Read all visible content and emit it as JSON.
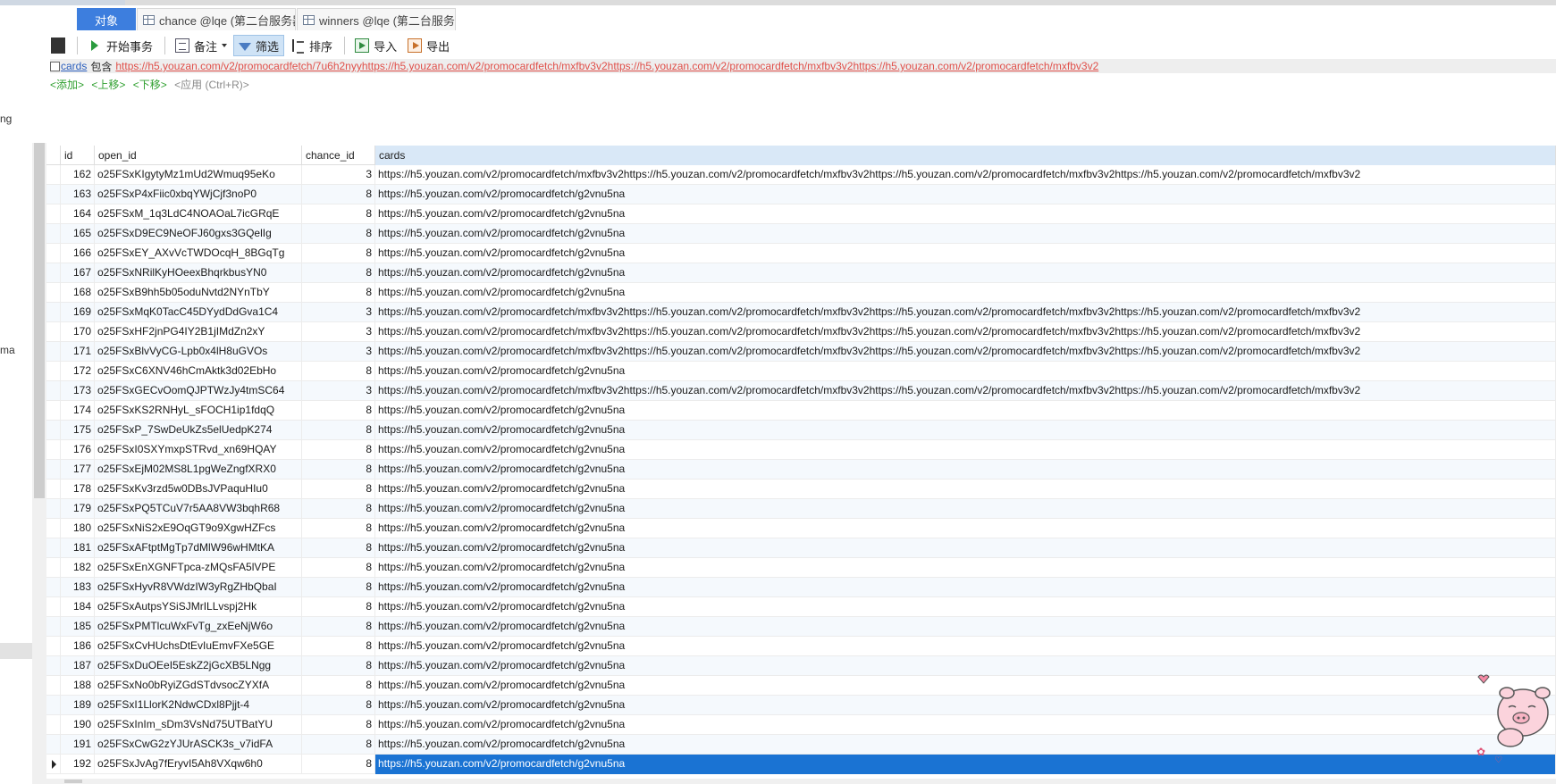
{
  "left_panel": {
    "fragments": [
      "ng",
      "ma"
    ]
  },
  "tabs": [
    {
      "label": "对象",
      "active": true,
      "icon": "none"
    },
    {
      "label": "chance @lqe (第二台服务器)",
      "active": false,
      "icon": "table-icon"
    },
    {
      "label": "winners @lqe (第二台服务器)...",
      "active": false,
      "icon": "table-icon"
    }
  ],
  "toolbar": {
    "begin_transaction": "开始事务",
    "note": "备注",
    "filter": "筛选",
    "sort": "排序",
    "import": "导入",
    "export": "导出"
  },
  "filter": {
    "field": "cards",
    "operator": "包含",
    "value": "https://h5.youzan.com/v2/promocardfetch/7u6h2nyyhttps://h5.youzan.com/v2/promocardfetch/mxfbv3v2https://h5.youzan.com/v2/promocardfetch/mxfbv3v2https://h5.youzan.com/v2/promocardfetch/mxfbv3v2",
    "actions": {
      "add": "<添加>",
      "move_up": "<上移>",
      "move_down": "<下移>",
      "apply": "<应用 (Ctrl+R)>"
    }
  },
  "grid": {
    "columns": [
      "id",
      "open_id",
      "chance_id",
      "cards"
    ],
    "rows": [
      {
        "id": "162",
        "open_id": "o25FSxKIgytyMz1mUd2Wmuq95eKo",
        "chance_id": "3",
        "cards": "https://h5.youzan.com/v2/promocardfetch/mxfbv3v2https://h5.youzan.com/v2/promocardfetch/mxfbv3v2https://h5.youzan.com/v2/promocardfetch/mxfbv3v2https://h5.youzan.com/v2/promocardfetch/mxfbv3v2"
      },
      {
        "id": "163",
        "open_id": "o25FSxP4xFiic0xbqYWjCjf3noP0",
        "chance_id": "8",
        "cards": "https://h5.youzan.com/v2/promocardfetch/g2vnu5na"
      },
      {
        "id": "164",
        "open_id": "o25FSxM_1q3LdC4NOAOaL7icGRqE",
        "chance_id": "8",
        "cards": "https://h5.youzan.com/v2/promocardfetch/g2vnu5na"
      },
      {
        "id": "165",
        "open_id": "o25FSxD9EC9NeOFJ60gxs3GQelIg",
        "chance_id": "8",
        "cards": "https://h5.youzan.com/v2/promocardfetch/g2vnu5na"
      },
      {
        "id": "166",
        "open_id": "o25FSxEY_AXvVcTWDOcqH_8BGqTg",
        "chance_id": "8",
        "cards": "https://h5.youzan.com/v2/promocardfetch/g2vnu5na"
      },
      {
        "id": "167",
        "open_id": "o25FSxNRilKyHOeexBhqrkbusYN0",
        "chance_id": "8",
        "cards": "https://h5.youzan.com/v2/promocardfetch/g2vnu5na"
      },
      {
        "id": "168",
        "open_id": "o25FSxB9hh5b05oduNvtd2NYnTbY",
        "chance_id": "8",
        "cards": "https://h5.youzan.com/v2/promocardfetch/g2vnu5na"
      },
      {
        "id": "169",
        "open_id": "o25FSxMqK0TacC45DYydDdGva1C4",
        "chance_id": "3",
        "cards": "https://h5.youzan.com/v2/promocardfetch/mxfbv3v2https://h5.youzan.com/v2/promocardfetch/mxfbv3v2https://h5.youzan.com/v2/promocardfetch/mxfbv3v2https://h5.youzan.com/v2/promocardfetch/mxfbv3v2"
      },
      {
        "id": "170",
        "open_id": "o25FSxHF2jnPG4IY2B1jIMdZn2xY",
        "chance_id": "3",
        "cards": "https://h5.youzan.com/v2/promocardfetch/mxfbv3v2https://h5.youzan.com/v2/promocardfetch/mxfbv3v2https://h5.youzan.com/v2/promocardfetch/mxfbv3v2https://h5.youzan.com/v2/promocardfetch/mxfbv3v2"
      },
      {
        "id": "171",
        "open_id": "o25FSxBlvVyCG-Lpb0x4lH8uGVOs",
        "chance_id": "3",
        "cards": "https://h5.youzan.com/v2/promocardfetch/mxfbv3v2https://h5.youzan.com/v2/promocardfetch/mxfbv3v2https://h5.youzan.com/v2/promocardfetch/mxfbv3v2https://h5.youzan.com/v2/promocardfetch/mxfbv3v2"
      },
      {
        "id": "172",
        "open_id": "o25FSxC6XNV46hCmAktk3d02EbHo",
        "chance_id": "8",
        "cards": "https://h5.youzan.com/v2/promocardfetch/g2vnu5na"
      },
      {
        "id": "173",
        "open_id": "o25FSxGECvOomQJPTWzJy4tmSC64",
        "chance_id": "3",
        "cards": "https://h5.youzan.com/v2/promocardfetch/mxfbv3v2https://h5.youzan.com/v2/promocardfetch/mxfbv3v2https://h5.youzan.com/v2/promocardfetch/mxfbv3v2https://h5.youzan.com/v2/promocardfetch/mxfbv3v2"
      },
      {
        "id": "174",
        "open_id": "o25FSxKS2RNHyL_sFOCH1ip1fdqQ",
        "chance_id": "8",
        "cards": "https://h5.youzan.com/v2/promocardfetch/g2vnu5na"
      },
      {
        "id": "175",
        "open_id": "o25FSxP_7SwDeUkZs5elUedpK274",
        "chance_id": "8",
        "cards": "https://h5.youzan.com/v2/promocardfetch/g2vnu5na"
      },
      {
        "id": "176",
        "open_id": "o25FSxI0SXYmxpSTRvd_xn69HQAY",
        "chance_id": "8",
        "cards": "https://h5.youzan.com/v2/promocardfetch/g2vnu5na"
      },
      {
        "id": "177",
        "open_id": "o25FSxEjM02MS8L1pgWeZngfXRX0",
        "chance_id": "8",
        "cards": "https://h5.youzan.com/v2/promocardfetch/g2vnu5na"
      },
      {
        "id": "178",
        "open_id": "o25FSxKv3rzd5w0DBsJVPaquHIu0",
        "chance_id": "8",
        "cards": "https://h5.youzan.com/v2/promocardfetch/g2vnu5na"
      },
      {
        "id": "179",
        "open_id": "o25FSxPQ5TCuV7r5AA8VW3bqhR68",
        "chance_id": "8",
        "cards": "https://h5.youzan.com/v2/promocardfetch/g2vnu5na"
      },
      {
        "id": "180",
        "open_id": "o25FSxNiS2xE9OqGT9o9XgwHZFcs",
        "chance_id": "8",
        "cards": "https://h5.youzan.com/v2/promocardfetch/g2vnu5na"
      },
      {
        "id": "181",
        "open_id": "o25FSxAFtptMgTp7dMlW96wHMtKA",
        "chance_id": "8",
        "cards": "https://h5.youzan.com/v2/promocardfetch/g2vnu5na"
      },
      {
        "id": "182",
        "open_id": "o25FSxEnXGNFTpca-zMQsFA5lVPE",
        "chance_id": "8",
        "cards": "https://h5.youzan.com/v2/promocardfetch/g2vnu5na"
      },
      {
        "id": "183",
        "open_id": "o25FSxHyvR8VWdzIW3yRgZHbQbaI",
        "chance_id": "8",
        "cards": "https://h5.youzan.com/v2/promocardfetch/g2vnu5na"
      },
      {
        "id": "184",
        "open_id": "o25FSxAutpsYSiSJMrILLvspj2Hk",
        "chance_id": "8",
        "cards": "https://h5.youzan.com/v2/promocardfetch/g2vnu5na"
      },
      {
        "id": "185",
        "open_id": "o25FSxPMTlcuWxFvTg_zxEeNjW6o",
        "chance_id": "8",
        "cards": "https://h5.youzan.com/v2/promocardfetch/g2vnu5na"
      },
      {
        "id": "186",
        "open_id": "o25FSxCvHUchsDtEvIuEmvFXe5GE",
        "chance_id": "8",
        "cards": "https://h5.youzan.com/v2/promocardfetch/g2vnu5na"
      },
      {
        "id": "187",
        "open_id": "o25FSxDuOEeI5EskZ2jGcXB5LNgg",
        "chance_id": "8",
        "cards": "https://h5.youzan.com/v2/promocardfetch/g2vnu5na"
      },
      {
        "id": "188",
        "open_id": "o25FSxNo0bRyiZGdSTdvsocZYXfA",
        "chance_id": "8",
        "cards": "https://h5.youzan.com/v2/promocardfetch/g2vnu5na"
      },
      {
        "id": "189",
        "open_id": "o25FSxI1LlorK2NdwCDxl8Pjjt-4",
        "chance_id": "8",
        "cards": "https://h5.youzan.com/v2/promocardfetch/g2vnu5na"
      },
      {
        "id": "190",
        "open_id": "o25FSxInIm_sDm3VsNd75UTBatYU",
        "chance_id": "8",
        "cards": "https://h5.youzan.com/v2/promocardfetch/g2vnu5na"
      },
      {
        "id": "191",
        "open_id": "o25FSxCwG2zYJUrASCK3s_v7idFA",
        "chance_id": "8",
        "cards": "https://h5.youzan.com/v2/promocardfetch/g2vnu5na"
      },
      {
        "id": "192",
        "open_id": "o25FSxJvAg7fEryvI5Ah8VXqw6h0",
        "chance_id": "8",
        "cards": "https://h5.youzan.com/v2/promocardfetch/g2vnu5na",
        "selected": true
      }
    ]
  },
  "colors": {
    "accent": "#3d7ede",
    "selection": "#1a73d3",
    "filter_value": "#e0504a",
    "action_link": "#30a030"
  },
  "decoration": {
    "mascot_icon": "pink-pig-sticker-icon"
  }
}
